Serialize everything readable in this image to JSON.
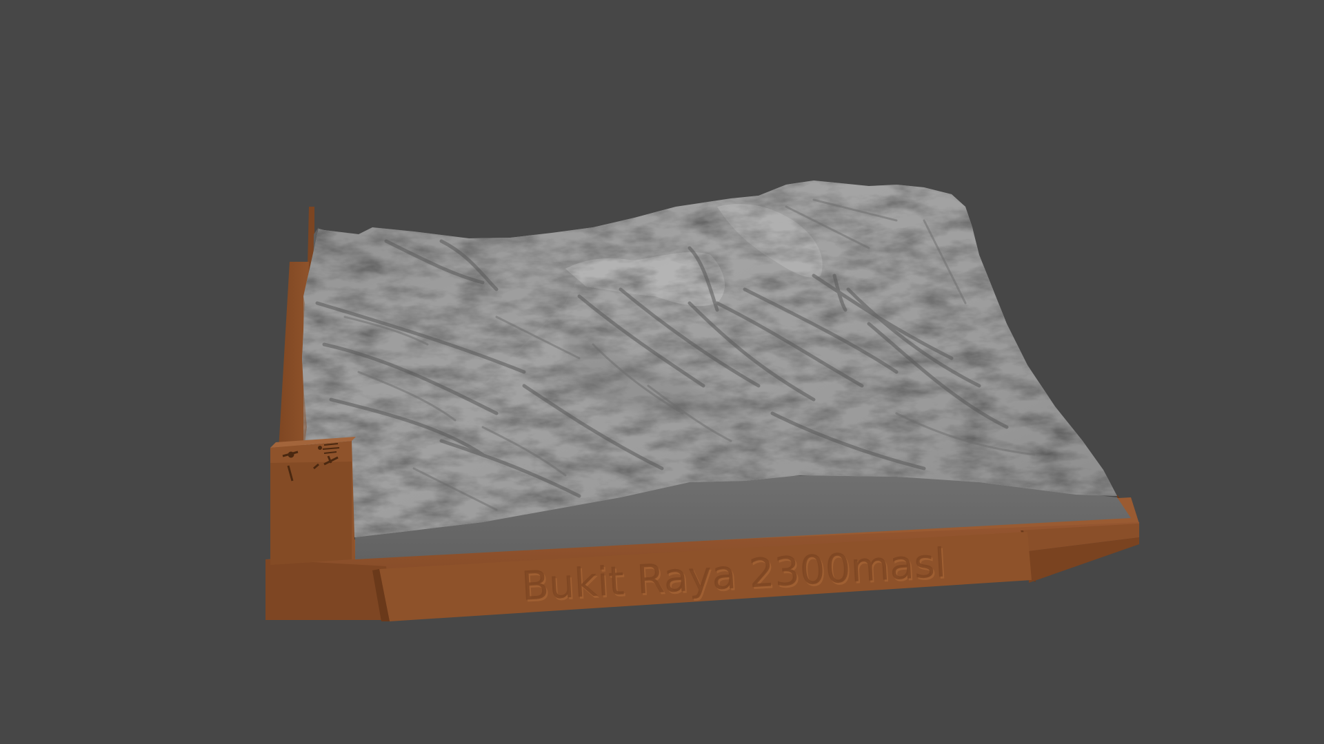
{
  "viewport": {
    "background": "#474747"
  },
  "model": {
    "terrain_color": "#a3a3a3",
    "terrain_side_color": "#6e6e6e",
    "base_color": "#8c5028",
    "base_dark_color": "#6e3d1c",
    "plaque_text": "Bukit Raya 2300masl",
    "badge_icons": [
      "hiker-icon",
      "compass-rose-icon",
      "hammer-icon"
    ]
  }
}
